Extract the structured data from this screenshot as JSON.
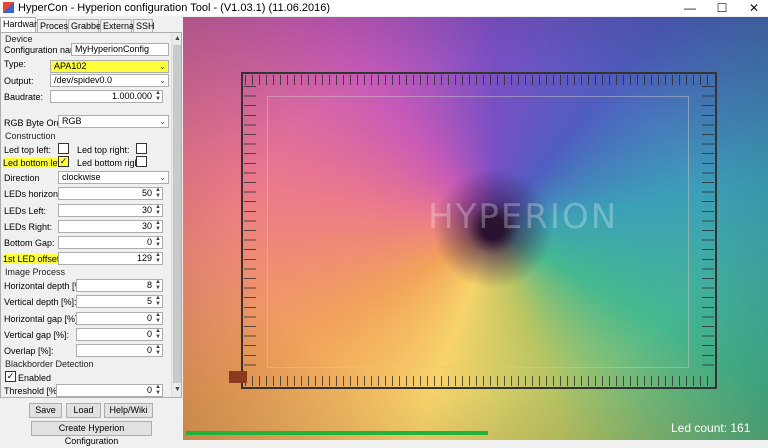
{
  "window": {
    "title": "HyperCon - Hyperion configuration Tool - (V1.03.1) (11.06.2016)",
    "minimize": "—",
    "maximize": "☐",
    "close": "✕"
  },
  "tabs": [
    {
      "label": "Hardware",
      "active": true
    },
    {
      "label": "Process"
    },
    {
      "label": "Grabber"
    },
    {
      "label": "External"
    },
    {
      "label": "SSH"
    }
  ],
  "device": {
    "group": "Device",
    "config_name_label": "Configuration name:",
    "config_name_value": "MyHyperionConfig",
    "type_label": "Type:",
    "type_value": "APA102",
    "output_label": "Output:",
    "output_value": "/dev/spidev0.0",
    "baudrate_label": "Baudrate:",
    "baudrate_value": "1.000.000",
    "rgb_order_label": "RGB Byte Order:",
    "rgb_order_value": "RGB"
  },
  "construction": {
    "group": "Construction",
    "led_top_left_label": "Led top left:",
    "led_top_right_label": "Led top right:",
    "led_bottom_left_label": "Led bottom left:",
    "led_bottom_right_label": "Led bottom right:",
    "led_top_left": false,
    "led_top_right": false,
    "led_bottom_left": true,
    "led_bottom_right": false,
    "direction_label": "Direction",
    "direction_value": "clockwise",
    "leds_horizontal_label": "LEDs horizontal:",
    "leds_horizontal": "50",
    "leds_left_label": "LEDs Left:",
    "leds_left": "30",
    "leds_right_label": "LEDs Right:",
    "leds_right": "30",
    "bottom_gap_label": "Bottom Gap:",
    "bottom_gap": "0",
    "first_led_offset_label": "1st LED offset",
    "first_led_offset": "129"
  },
  "image_process": {
    "group": "Image Process",
    "hdepth_label": "Horizontal depth [%]:",
    "hdepth": "8",
    "vdepth_label": "Vertical depth [%]:",
    "vdepth": "5",
    "hgap_label": "Horizontal gap [%]:",
    "hgap": "0",
    "vgap_label": "Vertical gap [%]:",
    "vgap": "0",
    "overlap_label": "Overlap [%]:",
    "overlap": "0"
  },
  "blackborder": {
    "group": "Blackborder Detection",
    "enabled_label": "Enabled",
    "enabled": true,
    "threshold_label": "Threshold [%]:",
    "threshold": "0"
  },
  "buttons": {
    "save": "Save",
    "load": "Load",
    "help": "Help/Wiki",
    "create": "Create Hyperion Configuration"
  },
  "preview": {
    "watermark": "HYPERION",
    "led_count": "Led count: 161",
    "progress": 0.52
  },
  "colors": {
    "highlight": "#ffff3a",
    "progress": "#21b33a"
  }
}
